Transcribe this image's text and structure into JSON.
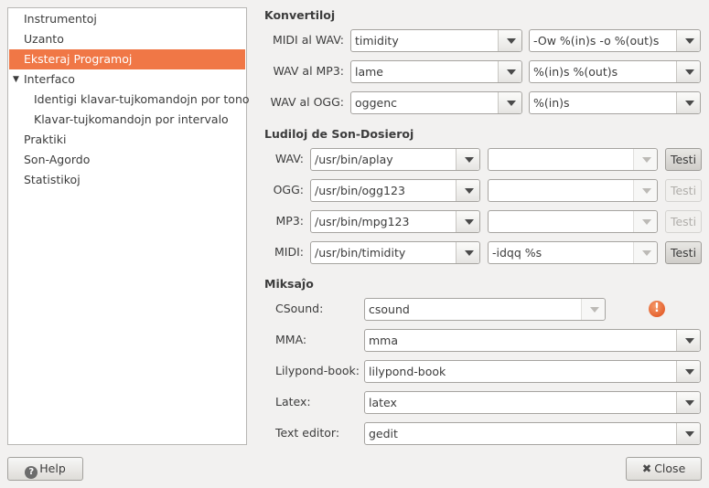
{
  "sidebar": {
    "items": [
      {
        "label": "Instrumentoj"
      },
      {
        "label": "Uzanto"
      },
      {
        "label": "Eksteraj Programoj"
      },
      {
        "label": "Interfaco"
      },
      {
        "label": "Identigi klavar-tujkomandojn por tono"
      },
      {
        "label": "Klavar-tujkomandojn por intervalo"
      },
      {
        "label": "Praktiki"
      },
      {
        "label": "Son-Agordo"
      },
      {
        "label": "Statistikoj"
      }
    ],
    "selected_index": 2,
    "expander_glyph": "▼"
  },
  "konvertiloj": {
    "title": "Konvertiloj",
    "rows": [
      {
        "label": "MIDI al WAV:",
        "program": "timidity",
        "args": "-Ow %(in)s -o %(out)s"
      },
      {
        "label": "WAV al MP3:",
        "program": "lame",
        "args": "%(in)s %(out)s"
      },
      {
        "label": "WAV al OGG:",
        "program": "oggenc",
        "args": "%(in)s"
      }
    ]
  },
  "ludiloj": {
    "title": "Ludiloj de Son-Dosieroj",
    "test_label": "Testi",
    "rows": [
      {
        "label": "WAV:",
        "path": "/usr/bin/aplay",
        "args": "",
        "test_enabled": true
      },
      {
        "label": "OGG:",
        "path": "/usr/bin/ogg123",
        "args": "",
        "test_enabled": false
      },
      {
        "label": "MP3:",
        "path": "/usr/bin/mpg123",
        "args": "",
        "test_enabled": false
      },
      {
        "label": "MIDI:",
        "path": "/usr/bin/timidity",
        "args": "-idqq %s",
        "test_enabled": true
      }
    ]
  },
  "miksajo": {
    "title": "Miksaĵo",
    "warning_glyph": "!",
    "rows": [
      {
        "label": "CSound:",
        "value": "csound"
      },
      {
        "label": "MMA:",
        "value": "mma"
      },
      {
        "label": "Lilypond-book:",
        "value": "lilypond-book"
      },
      {
        "label": "Latex:",
        "value": "latex"
      },
      {
        "label": "Text editor:",
        "value": "gedit"
      }
    ]
  },
  "buttons": {
    "help_label": "Help",
    "close_label": "Close",
    "help_glyph": "?",
    "close_glyph": "✖"
  },
  "colors": {
    "selection": "#f07746",
    "window_bg": "#f2f1f0",
    "warning": "#df4b17"
  }
}
